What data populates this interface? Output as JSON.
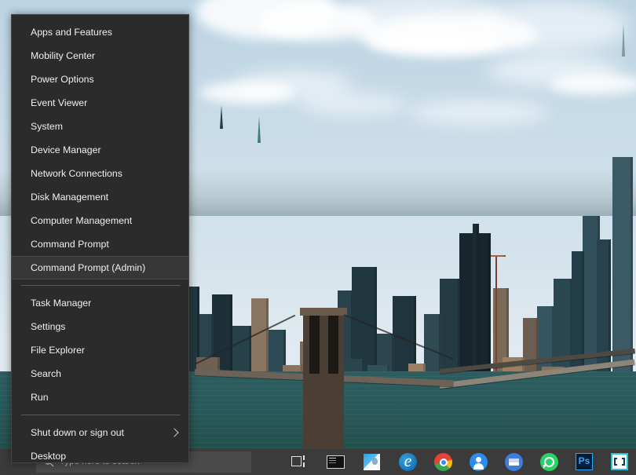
{
  "desktop": {
    "wallpaper_description": "New York City skyline with Brooklyn Bridge over the East River",
    "sky_color": "#c6dae7",
    "water_color": "#2a5a5c"
  },
  "winx_menu": {
    "groups": [
      {
        "items": [
          {
            "label": "Apps and Features",
            "name": "apps-and-features",
            "selected": false,
            "submenu": false
          },
          {
            "label": "Mobility Center",
            "name": "mobility-center",
            "selected": false,
            "submenu": false
          },
          {
            "label": "Power Options",
            "name": "power-options",
            "selected": false,
            "submenu": false
          },
          {
            "label": "Event Viewer",
            "name": "event-viewer",
            "selected": false,
            "submenu": false
          },
          {
            "label": "System",
            "name": "system",
            "selected": false,
            "submenu": false
          },
          {
            "label": "Device Manager",
            "name": "device-manager",
            "selected": false,
            "submenu": false
          },
          {
            "label": "Network Connections",
            "name": "network-connections",
            "selected": false,
            "submenu": false
          },
          {
            "label": "Disk Management",
            "name": "disk-management",
            "selected": false,
            "submenu": false
          },
          {
            "label": "Computer Management",
            "name": "computer-management",
            "selected": false,
            "submenu": false
          },
          {
            "label": "Command Prompt",
            "name": "command-prompt",
            "selected": false,
            "submenu": false
          },
          {
            "label": "Command Prompt (Admin)",
            "name": "command-prompt-admin",
            "selected": true,
            "submenu": false
          }
        ]
      },
      {
        "items": [
          {
            "label": "Task Manager",
            "name": "task-manager",
            "selected": false,
            "submenu": false
          },
          {
            "label": "Settings",
            "name": "settings",
            "selected": false,
            "submenu": false
          },
          {
            "label": "File Explorer",
            "name": "file-explorer",
            "selected": false,
            "submenu": false
          },
          {
            "label": "Search",
            "name": "search",
            "selected": false,
            "submenu": false
          },
          {
            "label": "Run",
            "name": "run",
            "selected": false,
            "submenu": false
          }
        ]
      },
      {
        "items": [
          {
            "label": "Shut down or sign out",
            "name": "shut-down-or-sign-out",
            "selected": false,
            "submenu": true
          },
          {
            "label": "Desktop",
            "name": "desktop",
            "selected": false,
            "submenu": false
          }
        ]
      }
    ],
    "background_color": "#2b2b2b",
    "selected_background_color": "#373737",
    "text_color": "#f0f0f0"
  },
  "taskbar": {
    "background_color": "#3b3b3b",
    "search": {
      "placeholder": "Type here to search",
      "value": ""
    },
    "icons": [
      {
        "name": "task-view-icon",
        "label": "Task View"
      },
      {
        "name": "command-prompt-icon",
        "label": "Command Prompt"
      },
      {
        "name": "photos-icon",
        "label": "Photos"
      },
      {
        "name": "edge-icon",
        "label": "Microsoft Edge"
      },
      {
        "name": "chrome-icon",
        "label": "Google Chrome"
      },
      {
        "name": "people-icon",
        "label": "People"
      },
      {
        "name": "mail-icon",
        "label": "Mail"
      },
      {
        "name": "whatsapp-icon",
        "label": "WhatsApp"
      },
      {
        "name": "photoshop-icon",
        "label": "Adobe Photoshop"
      },
      {
        "name": "brackets-icon",
        "label": "Brackets"
      }
    ],
    "photoshop_glyph": "Ps"
  }
}
